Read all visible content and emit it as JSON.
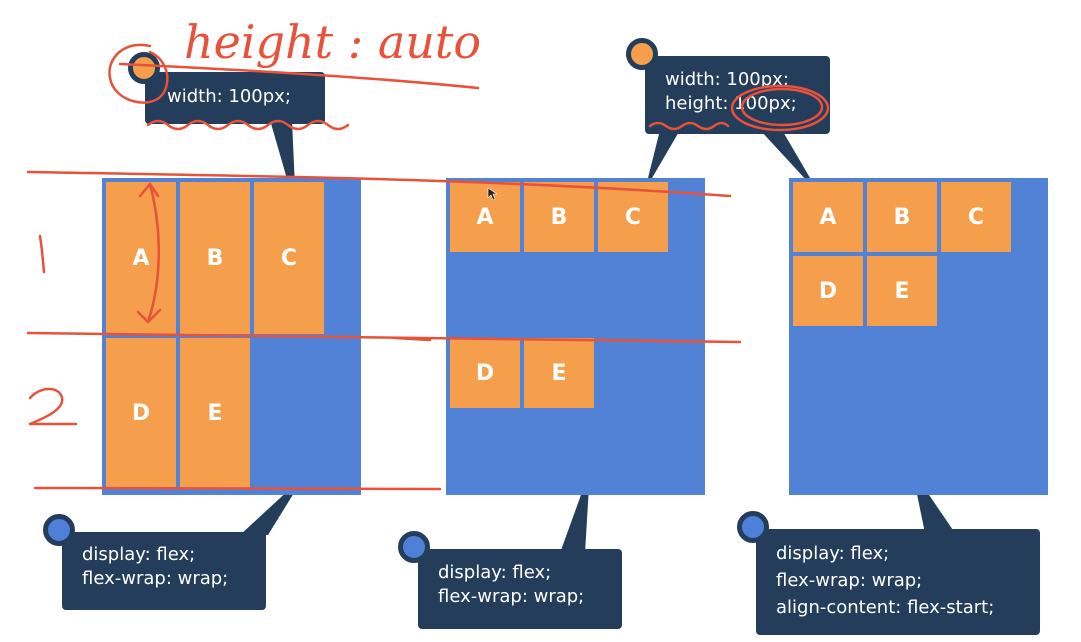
{
  "diagrams": [
    {
      "items": [
        "A",
        "B",
        "C",
        "D",
        "E"
      ],
      "code_lines": [
        "display: flex;",
        "flex-wrap: wrap;"
      ],
      "item_css_lines": [
        "width: 100px;"
      ]
    },
    {
      "items": [
        "A",
        "B",
        "C",
        "D",
        "E"
      ],
      "code_lines": [
        "display: flex;",
        "flex-wrap: wrap;"
      ],
      "item_css_lines": [
        "width: 100px;",
        "height: 100px;"
      ]
    },
    {
      "items": [
        "A",
        "B",
        "C",
        "D",
        "E"
      ],
      "code_lines": [
        "display: flex;",
        "flex-wrap: wrap;",
        "align-content: flex-start;"
      ]
    }
  ],
  "handwriting": {
    "height_note": "height : auto",
    "row_1": "1",
    "row_2": "2"
  },
  "colors": {
    "container": "#5282d6",
    "item": "#f59e4c",
    "callout": "#233d5a",
    "dot_orange": "#f59e4c",
    "dot_blue": "#4f7fd8",
    "pen": "#e8513a"
  }
}
